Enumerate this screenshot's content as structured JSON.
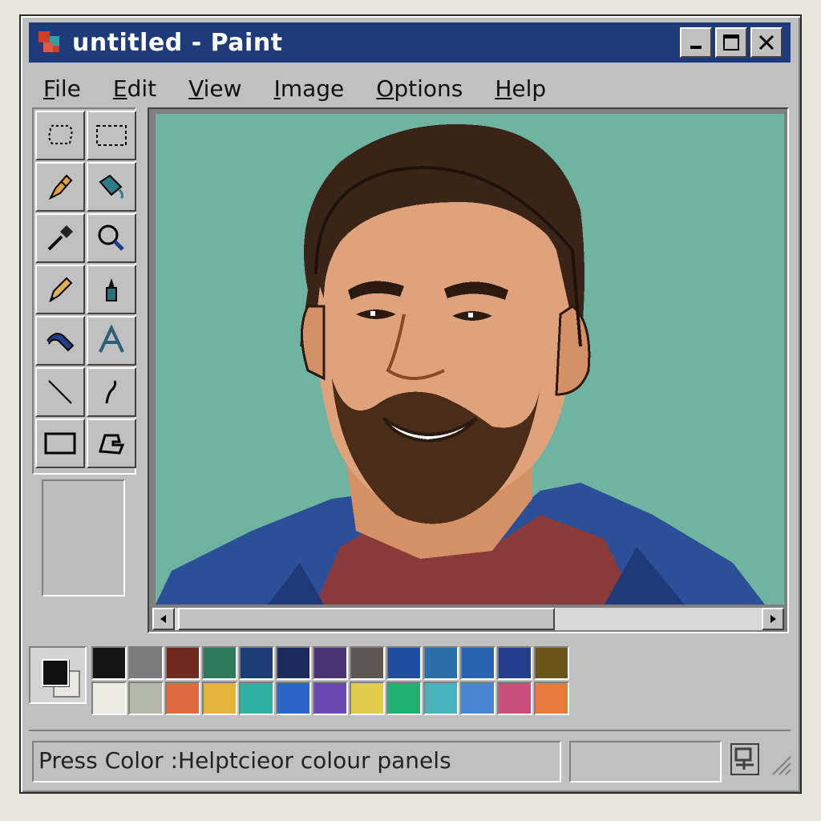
{
  "window": {
    "title": "untitled - Paint",
    "controls": [
      "minimize-icon",
      "maximize-icon",
      "close-icon"
    ]
  },
  "menu": [
    {
      "label": "File",
      "accel": "F",
      "rest": "ile"
    },
    {
      "label": "Edit",
      "accel": "E",
      "rest": "dit"
    },
    {
      "label": "View",
      "accel": "V",
      "rest": "iew"
    },
    {
      "label": "Image",
      "accel": "I",
      "rest": "mage"
    },
    {
      "label": "Options",
      "accel": "O",
      "rest": "ptions"
    },
    {
      "label": "Help",
      "accel": "H",
      "rest": "elp"
    }
  ],
  "tools": [
    "free-form-select-icon",
    "rect-select-icon",
    "eraser-icon",
    "fill-bucket-icon",
    "eyedropper-icon",
    "magnifier-icon",
    "pencil-icon",
    "brush-icon",
    "airbrush-icon",
    "text-icon",
    "line-icon",
    "curve-icon",
    "rectangle-icon",
    "polygon-icon"
  ],
  "palette": {
    "foreground": "#111111",
    "background": "#e8e8e0",
    "row1": [
      "#141414",
      "#7c7c7c",
      "#6e2a1c",
      "#2e7a5a",
      "#1d3e72",
      "#1f2a5c",
      "#4a3472",
      "#5e5650",
      "#1f4ea0",
      "#2a6fa8",
      "#2a64b0",
      "#233e8c",
      "#6a5418"
    ],
    "row2": [
      "#ecebe2",
      "#b1b8aa",
      "#e06a40",
      "#e2b43a",
      "#2fb0a0",
      "#2a66c8",
      "#6a48b2",
      "#e2cc50",
      "#22b070",
      "#46b2bc",
      "#4a84d0",
      "#c8507a",
      "#e47a3c"
    ]
  },
  "statusbar": {
    "text": "Press Color :Helptcieor colour panels"
  }
}
